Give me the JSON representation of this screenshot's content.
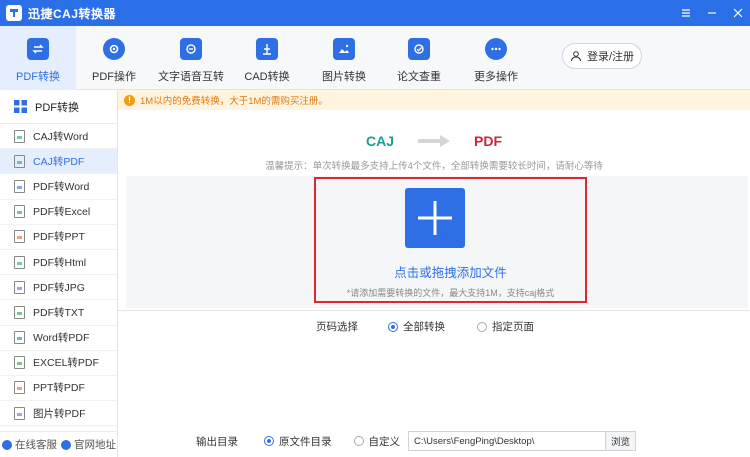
{
  "window": {
    "title": "迅捷CAJ转换器"
  },
  "toolbar": {
    "tools": [
      {
        "label": "PDF转换",
        "icon": "convert-icon",
        "active": true
      },
      {
        "label": "PDF操作",
        "icon": "gear-icon"
      },
      {
        "label": "文字语音互转",
        "icon": "text-speech-icon"
      },
      {
        "label": "CAD转换",
        "icon": "cad-icon"
      },
      {
        "label": "图片转换",
        "icon": "image-icon"
      },
      {
        "label": "论文查重",
        "icon": "paper-check-icon"
      },
      {
        "label": "更多操作",
        "icon": "more-icon"
      }
    ],
    "login_label": "登录/注册"
  },
  "sidebar": {
    "header": "PDF转换",
    "items": [
      {
        "label": "CAJ转Word"
      },
      {
        "label": "CAJ转PDF",
        "active": true
      },
      {
        "label": "PDF转Word"
      },
      {
        "label": "PDF转Excel"
      },
      {
        "label": "PDF转PPT"
      },
      {
        "label": "PDF转Html"
      },
      {
        "label": "PDF转JPG"
      },
      {
        "label": "PDF转TXT"
      },
      {
        "label": "Word转PDF"
      },
      {
        "label": "EXCEL转PDF"
      },
      {
        "label": "PPT转PDF"
      },
      {
        "label": "图片转PDF"
      }
    ],
    "footer": {
      "service": "在线客服",
      "website": "官网地址"
    }
  },
  "notice": "1M以内的免费转换，大于1M的需购买注册。",
  "conversion": {
    "from": "CAJ",
    "to": "PDF"
  },
  "tip": "温馨提示：单次转换最多支持上传4个文件，全部转换需要较长时间，请耐心等待",
  "dropzone": {
    "title": "点击或拖拽添加文件",
    "subtitle": "*请添加需要转换的文件，最大支持1M，支持caj格式"
  },
  "page_select": {
    "label": "页码选择",
    "options": [
      "全部转换",
      "指定页面"
    ],
    "selected": "全部转换"
  },
  "output": {
    "label": "输出目录",
    "options": [
      "原文件目录",
      "自定义"
    ],
    "selected": "原文件目录",
    "path": "C:\\Users\\FengPing\\Desktop\\",
    "browse_label": "浏览"
  },
  "colors": {
    "accent": "#2f6fe6",
    "highlight_border": "#e0262f",
    "caj": "#1a9e94",
    "pdf": "#d0243b"
  }
}
